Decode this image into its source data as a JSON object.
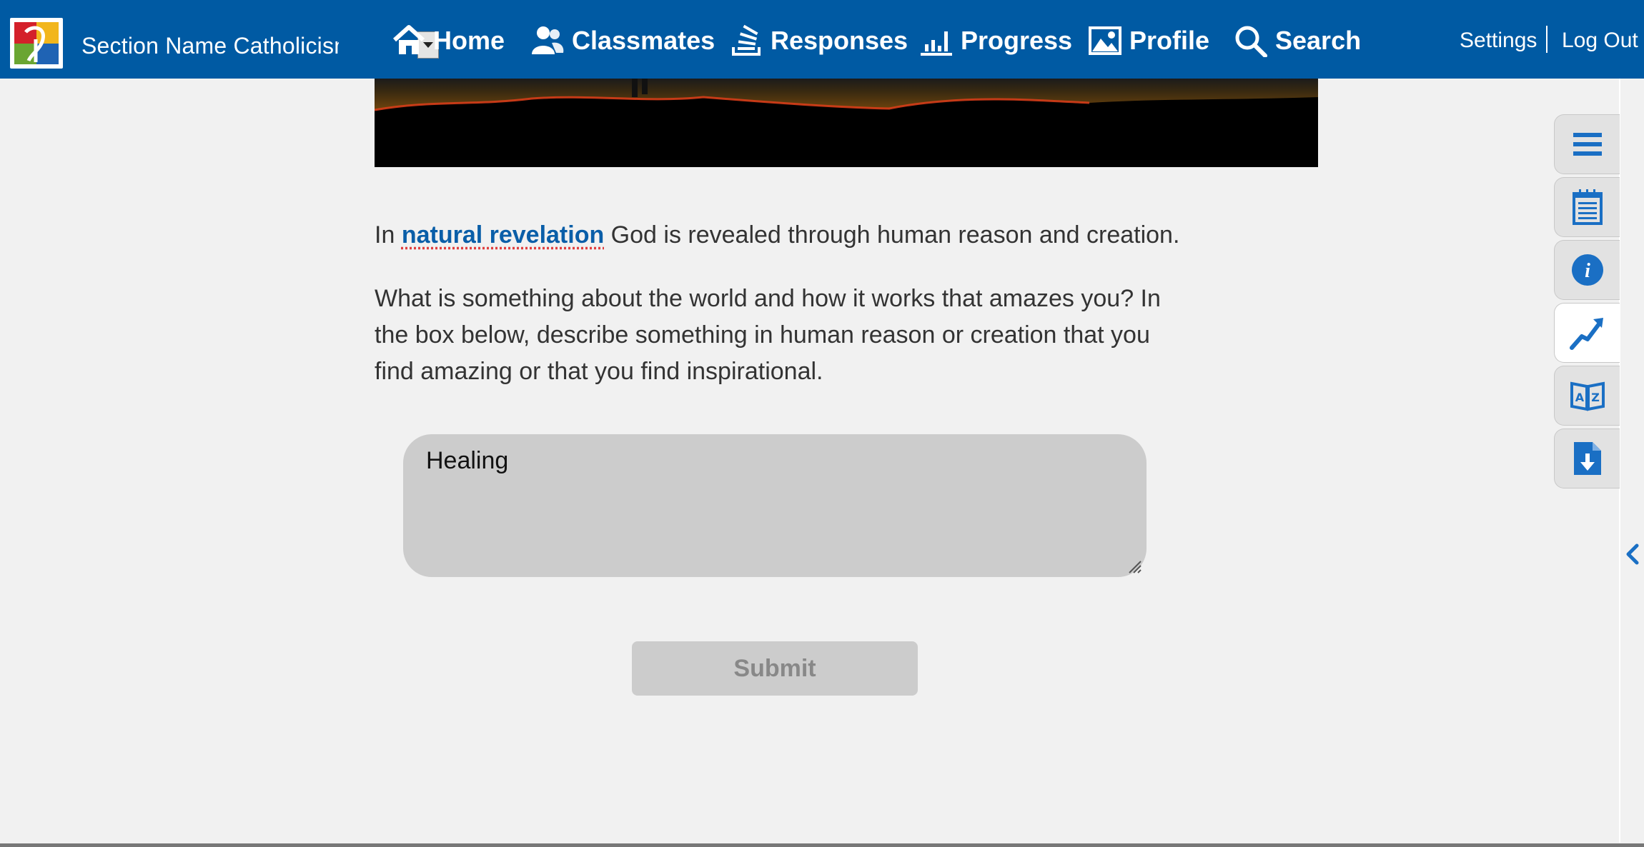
{
  "header": {
    "section_name": "Section Name Catholicism",
    "nav": [
      {
        "label": "Home",
        "icon": "home-icon"
      },
      {
        "label": "Classmates",
        "icon": "classmates-icon"
      },
      {
        "label": "Responses",
        "icon": "responses-icon"
      },
      {
        "label": "Progress",
        "icon": "progress-icon"
      },
      {
        "label": "Profile",
        "icon": "profile-icon"
      },
      {
        "label": "Search",
        "icon": "search-icon"
      }
    ],
    "settings_label": "Settings",
    "separator": "|",
    "logout_label": "Log Out"
  },
  "content": {
    "intro_before": "In ",
    "intro_term": "natural revelation",
    "intro_after": " God is revealed through human reason and creation.",
    "prompt": "What is something about the world and how it works that amazes you? In the box below, describe something in human reason or creation that you find amazing or that you find inspirational.",
    "answer_value": "Healing",
    "submit_label": "Submit"
  },
  "side_tools": [
    {
      "icon": "menu-icon",
      "active": false
    },
    {
      "icon": "notepad-icon",
      "active": false
    },
    {
      "icon": "info-icon",
      "active": false
    },
    {
      "icon": "trend-arrow-icon",
      "active": true
    },
    {
      "icon": "glossary-az-icon",
      "active": false
    },
    {
      "icon": "download-file-icon",
      "active": false
    }
  ],
  "colors": {
    "brand_blue": "#005aa3",
    "link_blue": "#0a5ea8",
    "tool_blue": "#1a6fc4",
    "background": "#f1f1f1",
    "input_gray": "#cccccc"
  }
}
